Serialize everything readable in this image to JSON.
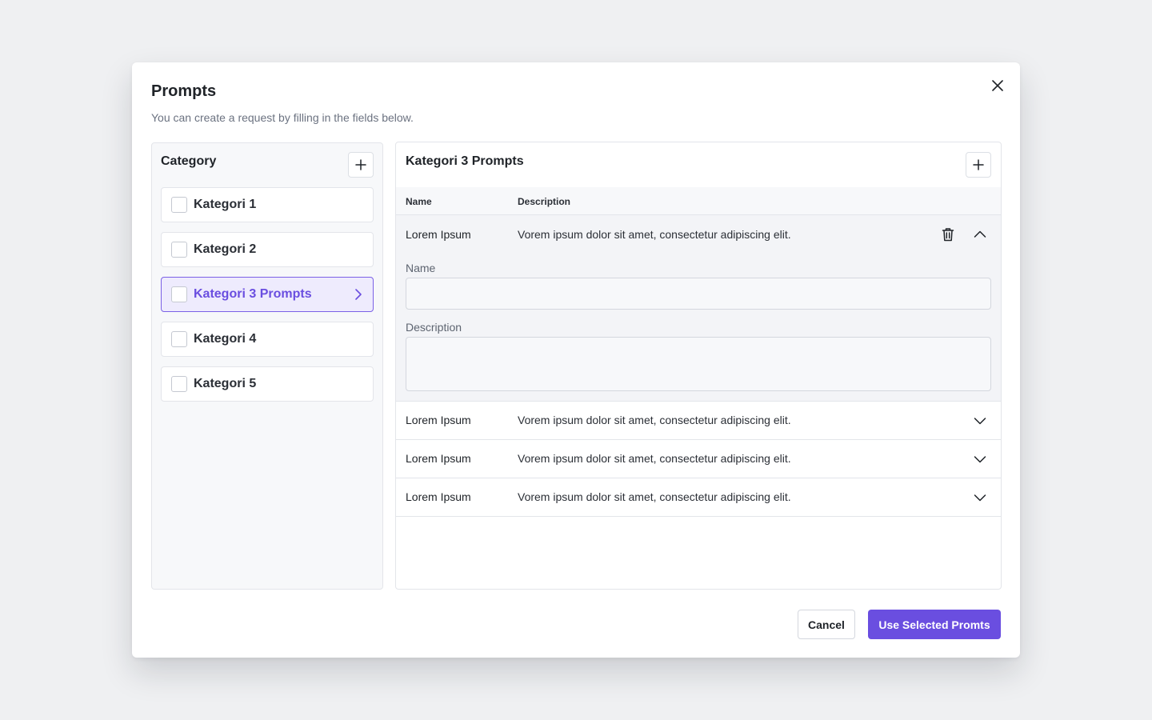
{
  "modal": {
    "title": "Prompts",
    "subtitle": "You can create a request by filling in the fields below."
  },
  "category": {
    "title": "Category",
    "items": [
      {
        "label": "Kategori 1",
        "active": false,
        "checked": false
      },
      {
        "label": "Kategori 2",
        "active": false,
        "checked": false
      },
      {
        "label": "Kategori 3 Prompts",
        "active": true,
        "checked": false
      },
      {
        "label": "Kategori 4",
        "active": false,
        "checked": false
      },
      {
        "label": "Kategori 5",
        "active": false,
        "checked": false
      }
    ]
  },
  "prompts": {
    "title": "Kategori 3 Prompts",
    "columns": {
      "name": "Name",
      "description": "Description"
    },
    "rows": [
      {
        "name": "Lorem Ipsum",
        "description": "Vorem ipsum dolor sit amet, consectetur adipiscing elit.",
        "expanded": true
      },
      {
        "name": "Lorem Ipsum",
        "description": "Vorem ipsum dolor sit amet, consectetur adipiscing elit.",
        "expanded": false
      },
      {
        "name": "Lorem Ipsum",
        "description": "Vorem ipsum dolor sit amet, consectetur adipiscing elit.",
        "expanded": false
      },
      {
        "name": "Lorem Ipsum",
        "description": "Vorem ipsum dolor sit amet, consectetur adipiscing elit.",
        "expanded": false
      }
    ],
    "edit_form": {
      "name_label": "Name",
      "name_value": "",
      "description_label": "Description",
      "description_value": ""
    }
  },
  "footer": {
    "cancel_label": "Cancel",
    "primary_label": "Use Selected Promts"
  },
  "icons": {
    "close": "close-icon",
    "add": "plus-icon",
    "trash": "trash-icon",
    "chevron_up": "chevron-up-icon",
    "chevron_down": "chevron-down-icon",
    "chevron_right": "chevron-right-icon"
  },
  "colors": {
    "accent": "#6a4ee0",
    "active_bg": "#eeebfd",
    "background": "#eff0f2"
  }
}
